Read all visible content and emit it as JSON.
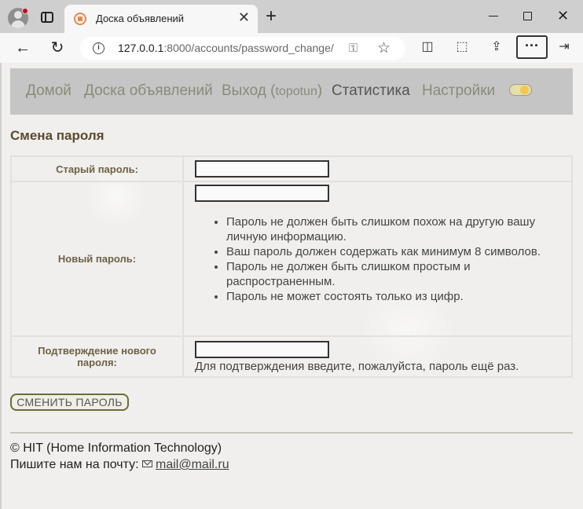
{
  "browser": {
    "tab_title": "Доска объявлений",
    "tab_close": "✕",
    "new_tab": "+",
    "url_host": "127.0.0.1",
    "url_rest": ":8000/accounts/password_change/",
    "window_close": "✕",
    "more": "···"
  },
  "nav": {
    "home": "Домой",
    "board": "Доска объявлений",
    "logout": "Выход (",
    "username": "topotun",
    "logout_close": ")",
    "stats": "Статистика",
    "settings": "Настройки"
  },
  "page": {
    "title": "Смена пароля"
  },
  "form": {
    "old_password_label": "Старый пароль:",
    "new_password_label": "Новый пароль:",
    "confirm_label": "Подтверждение нового пароля:",
    "hints": [
      "Пароль не должен быть слишком похож на другую вашу личную информацию.",
      "Ваш пароль должен содержать как минимум 8 символов.",
      "Пароль не должен быть слишком простым и распространенным.",
      "Пароль не может состоять только из цифр."
    ],
    "confirm_help": "Для подтверждения введите, пожалуйста, пароль ещё раз.",
    "submit_label": "СМЕНИТЬ ПАРОЛЬ",
    "old_password_value": "",
    "new_password_value": "",
    "confirm_value": ""
  },
  "footer": {
    "copyright": "© HIT (Home Information Technology)",
    "mail_prefix": "Пишите нам на почту: ",
    "mail_link": "mail@mail.ru"
  },
  "icons": {
    "back": "←",
    "reload": "↻",
    "star": "☆",
    "key": "⚿"
  }
}
